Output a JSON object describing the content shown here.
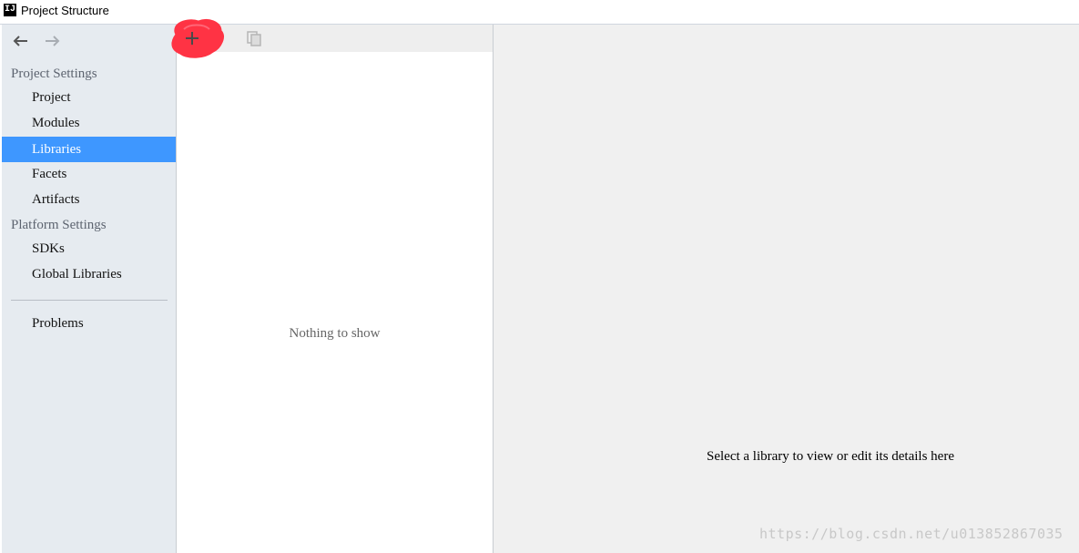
{
  "window": {
    "title": "Project Structure",
    "app_icon": "IJ"
  },
  "sidebar": {
    "back_icon": "arrow-left-icon",
    "forward_icon": "arrow-right-icon",
    "sections": {
      "project_settings": "Project Settings",
      "platform_settings": "Platform Settings"
    },
    "items": [
      {
        "label": "Project"
      },
      {
        "label": "Modules"
      },
      {
        "label": "Libraries",
        "selected": true
      },
      {
        "label": "Facets"
      },
      {
        "label": "Artifacts"
      },
      {
        "label": "SDKs"
      },
      {
        "label": "Global Libraries"
      },
      {
        "label": "Problems"
      }
    ]
  },
  "middle": {
    "toolbar": {
      "add_icon": "plus-icon",
      "copy_icon": "copy-icon",
      "annotation": "red-circle-highlight"
    },
    "empty_text": "Nothing to show"
  },
  "right": {
    "hint": "Select a library to view or edit its details here"
  },
  "watermark": "https://blog.csdn.net/u013852867035",
  "colors": {
    "selected": "#3e97ff",
    "sidebar_bg": "#e6ebf0",
    "annotation_red": "#ff3344"
  }
}
